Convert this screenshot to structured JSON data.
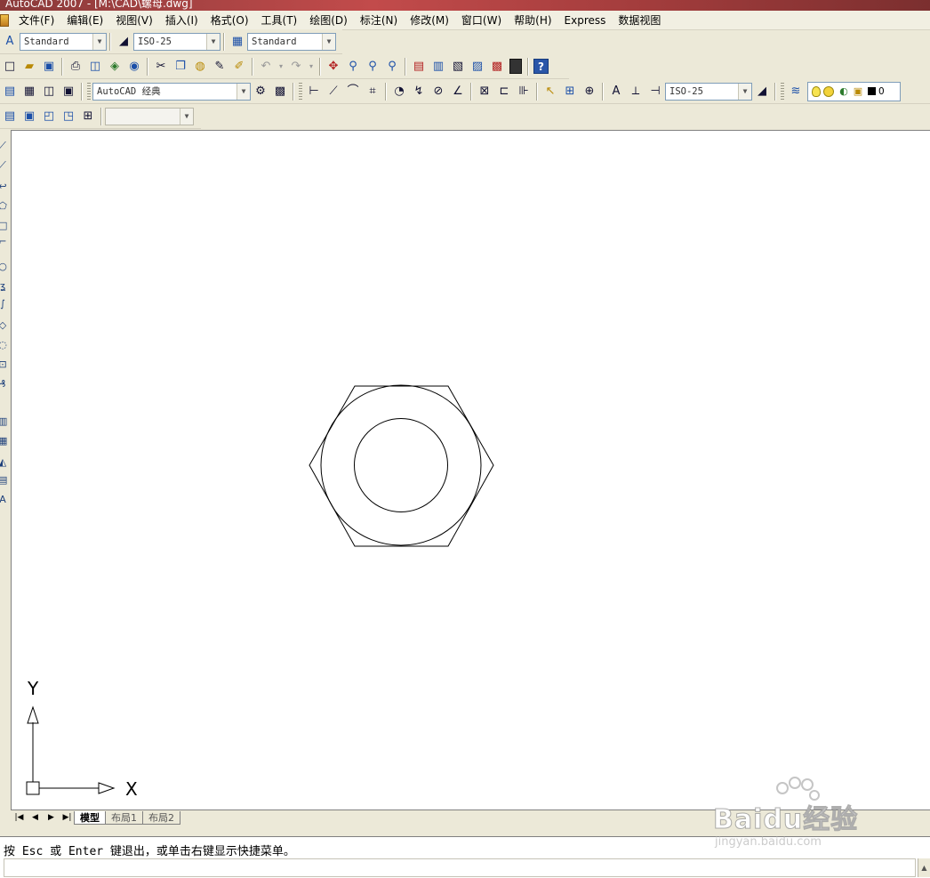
{
  "window": {
    "title": "AutoCAD 2007 - [M:\\CAD\\螺母.dwg]"
  },
  "menu": {
    "items": [
      "文件(F)",
      "编辑(E)",
      "视图(V)",
      "插入(I)",
      "格式(O)",
      "工具(T)",
      "绘图(D)",
      "标注(N)",
      "修改(M)",
      "窗口(W)",
      "帮助(H)",
      "Express",
      "数据视图"
    ]
  },
  "styles_toolbar": {
    "text_style": "Standard",
    "dim_style": "ISO-25",
    "table_style": "Standard"
  },
  "workspace_toolbar": {
    "workspace": "AutoCAD 经典"
  },
  "dimension_toolbar": {
    "dim_style": "ISO-25"
  },
  "layers_toolbar": {
    "current_layer": "0"
  },
  "layouts": {
    "tabs": [
      "模型",
      "布局1",
      "布局2"
    ],
    "active": "模型"
  },
  "ucs": {
    "x_label": "X",
    "y_label": "Y"
  },
  "command_line": {
    "history": "按 Esc 或 Enter 键退出，或单击右键显示快捷菜单。",
    "input": ""
  },
  "watermark": {
    "logo": "Baidu经验",
    "url": "jingyan.baidu.com"
  },
  "icons": {
    "help": "?"
  }
}
